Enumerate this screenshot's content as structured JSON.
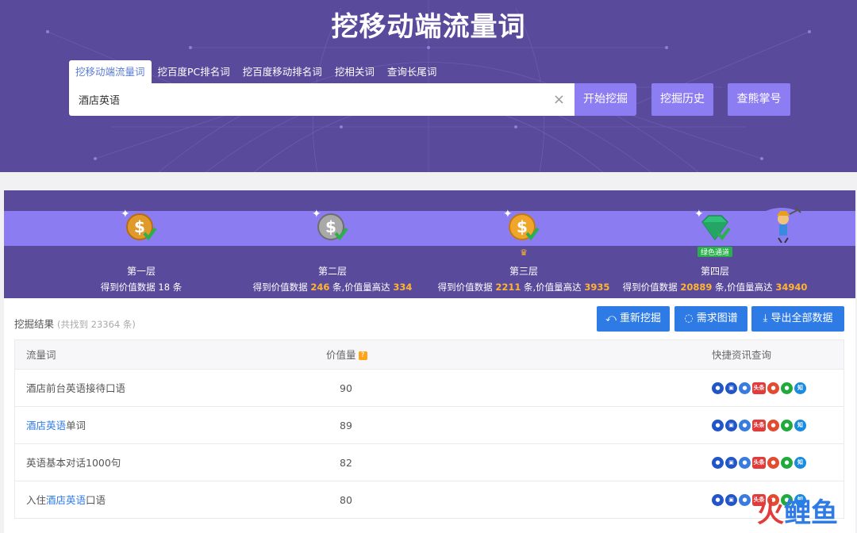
{
  "header": {
    "title": "挖移动端流量词",
    "tabs": [
      "挖移动端流量词",
      "挖百度PC排名词",
      "挖百度移动排名词",
      "挖相关词",
      "查询长尾词"
    ],
    "active_tab": 0,
    "search_value": "酒店英语",
    "clear_icon": "close-icon",
    "buttons": {
      "start": "开始挖掘",
      "history": "挖掘历史",
      "check": "查熊掌号"
    }
  },
  "levels": [
    {
      "name": "第一层",
      "desc_prefix": "得到价值数据 18 条",
      "count": "",
      "mid": "",
      "max": "",
      "coin": "gold-coin-icon"
    },
    {
      "name": "第二层",
      "desc_prefix": "得到价值数据",
      "count": "246",
      "mid": "条,价值量高达",
      "max": "334",
      "coin": "silver-coin-icon"
    },
    {
      "name": "第三层",
      "desc_prefix": "得到价值数据",
      "count": "2211",
      "mid": "条,价值量高达",
      "max": "3935",
      "coin": "gold-coin-icon"
    },
    {
      "name": "第四层",
      "desc_prefix": "得到价值数据",
      "count": "20889",
      "mid": "条,价值量高达",
      "max": "34940",
      "coin": "green-diamond-icon",
      "badge": "绿色通道"
    }
  ],
  "results": {
    "title": "挖掘结果",
    "count_text": "(共找到 23364 条)",
    "buttons": {
      "retry": "重新挖掘",
      "graph": "需求图谱",
      "export": "导出全部数据"
    },
    "columns": [
      "流量词",
      "价值量",
      "快捷资讯查询"
    ],
    "rows": [
      {
        "pre": "酒店前台英语接待口语",
        "hl": "",
        "post": "",
        "value": "90"
      },
      {
        "pre": "",
        "hl": "酒店英语",
        "post": "单词",
        "value": "89"
      },
      {
        "pre": "英语基本对话1000句",
        "hl": "",
        "post": "",
        "value": "82"
      },
      {
        "pre": "入住",
        "hl": "酒店英语",
        "post": "口语",
        "value": "80"
      }
    ],
    "quick_icons": [
      {
        "name": "baidu-icon",
        "glyph": "●"
      },
      {
        "name": "doc-icon",
        "glyph": "▣"
      },
      {
        "name": "baike-icon",
        "glyph": "●"
      },
      {
        "name": "toutiao-icon",
        "glyph": "头条"
      },
      {
        "name": "weibo-icon",
        "glyph": "●"
      },
      {
        "name": "wechat-icon",
        "glyph": "●"
      },
      {
        "name": "zhihu-icon",
        "glyph": "知"
      }
    ]
  },
  "watermark": {
    "part1": "火",
    "part2": "鲤鱼"
  }
}
